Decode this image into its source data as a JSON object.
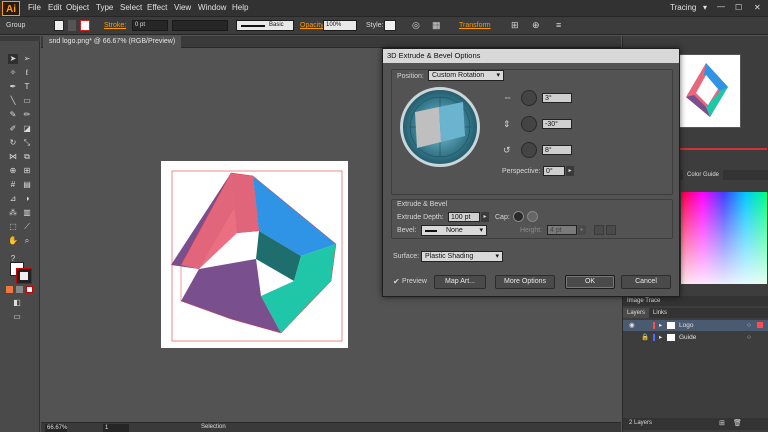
{
  "menubar": {
    "logo": "Ai",
    "items": [
      "File",
      "Edit",
      "Object",
      "Type",
      "Select",
      "Effect",
      "View",
      "Window",
      "Help"
    ],
    "workspace": "Tracing"
  },
  "controlbar": {
    "selection_label": "Group",
    "stroke_label": "Stroke:",
    "stroke_value": "0 pt",
    "brush_label": "Basic",
    "opacity_label": "Opacity:",
    "opacity_value": "100%",
    "style_label": "Style:",
    "transform_label": "Transform"
  },
  "document": {
    "tab_title": "snd logo.png* @ 66.67% (RGB/Preview)",
    "zoom": "66.67%",
    "page": "1",
    "status_text": "Selection"
  },
  "dialog": {
    "title": "3D Extrude & Bevel Options",
    "position_label": "Position:",
    "position_value": "Custom Rotation",
    "rotation_x": "3°",
    "rotation_y": "-30°",
    "rotation_z": "8°",
    "perspective_label": "Perspective:",
    "perspective_value": "0°",
    "extrude_section": "Extrude & Bevel",
    "extrude_depth_label": "Extrude Depth:",
    "extrude_depth_value": "100 pt",
    "cap_label": "Cap:",
    "bevel_label": "Bevel:",
    "bevel_value": "None",
    "height_label": "Height:",
    "height_value": "4 pt",
    "surface_label": "Surface:",
    "surface_value": "Plastic Shading",
    "preview_label": "Preview",
    "map_art_button": "Map Art...",
    "more_options_button": "More Options",
    "ok_button": "OK",
    "cancel_button": "Cancel"
  },
  "rightpanel": {
    "color_tab": "Color Guide",
    "image_trace_tab": "Image Trace",
    "layers_tab": "Layers",
    "links_tab": "Links",
    "layers": [
      {
        "name": "Logo",
        "color": "#ff4d4d"
      },
      {
        "name": "Guide",
        "color": "#4d6bff"
      }
    ],
    "layers_count": "2 Layers"
  },
  "colors": {
    "accent": "#ff9a00",
    "shape_pink": "#e8677a",
    "shape_blue": "#2f93e6",
    "shape_teal": "#1fc7a8",
    "shape_purple": "#7a4f8e"
  }
}
